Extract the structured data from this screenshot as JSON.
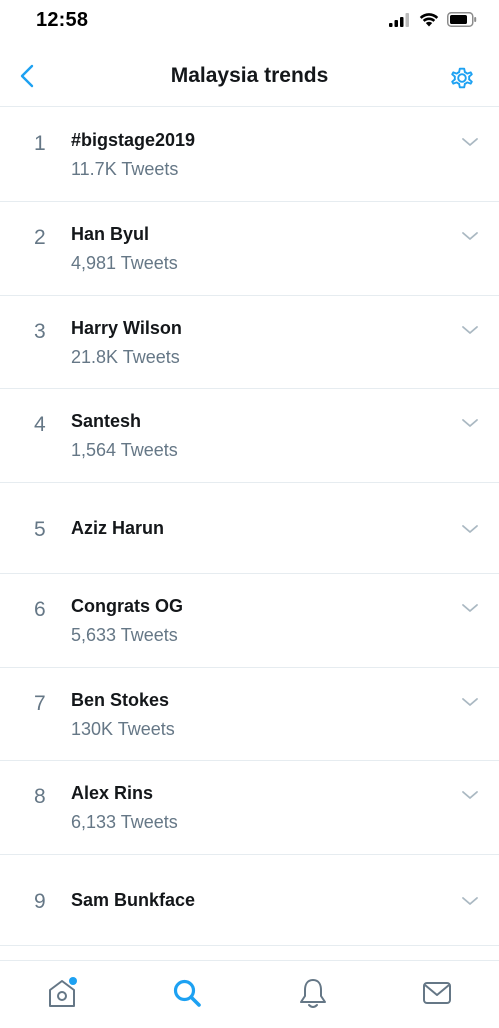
{
  "status_bar": {
    "time": "12:58"
  },
  "nav": {
    "title": "Malaysia trends",
    "back_icon": "chevron-left-icon",
    "settings_icon": "gear-icon"
  },
  "colors": {
    "accent": "#1da1f2",
    "secondary_text": "#657786",
    "divider": "#e6ecf0",
    "primary_text": "#14171a"
  },
  "trends": [
    {
      "rank": "1",
      "name": "#bigstage2019",
      "count": "11.7K Tweets"
    },
    {
      "rank": "2",
      "name": "Han Byul",
      "count": "4,981 Tweets"
    },
    {
      "rank": "3",
      "name": "Harry Wilson",
      "count": "21.8K Tweets"
    },
    {
      "rank": "4",
      "name": "Santesh",
      "count": "1,564 Tweets"
    },
    {
      "rank": "5",
      "name": "Aziz Harun",
      "count": ""
    },
    {
      "rank": "6",
      "name": "Congrats OG",
      "count": "5,633 Tweets"
    },
    {
      "rank": "7",
      "name": "Ben Stokes",
      "count": "130K Tweets"
    },
    {
      "rank": "8",
      "name": "Alex Rins",
      "count": "6,133 Tweets"
    },
    {
      "rank": "9",
      "name": "Sam Bunkface",
      "count": ""
    }
  ],
  "tab_bar": {
    "tabs": [
      {
        "name": "home",
        "icon": "home-icon",
        "active": false,
        "badge": true
      },
      {
        "name": "search",
        "icon": "search-icon",
        "active": true,
        "badge": false
      },
      {
        "name": "notifications",
        "icon": "bell-icon",
        "active": false,
        "badge": false
      },
      {
        "name": "messages",
        "icon": "mail-icon",
        "active": false,
        "badge": false
      }
    ]
  }
}
